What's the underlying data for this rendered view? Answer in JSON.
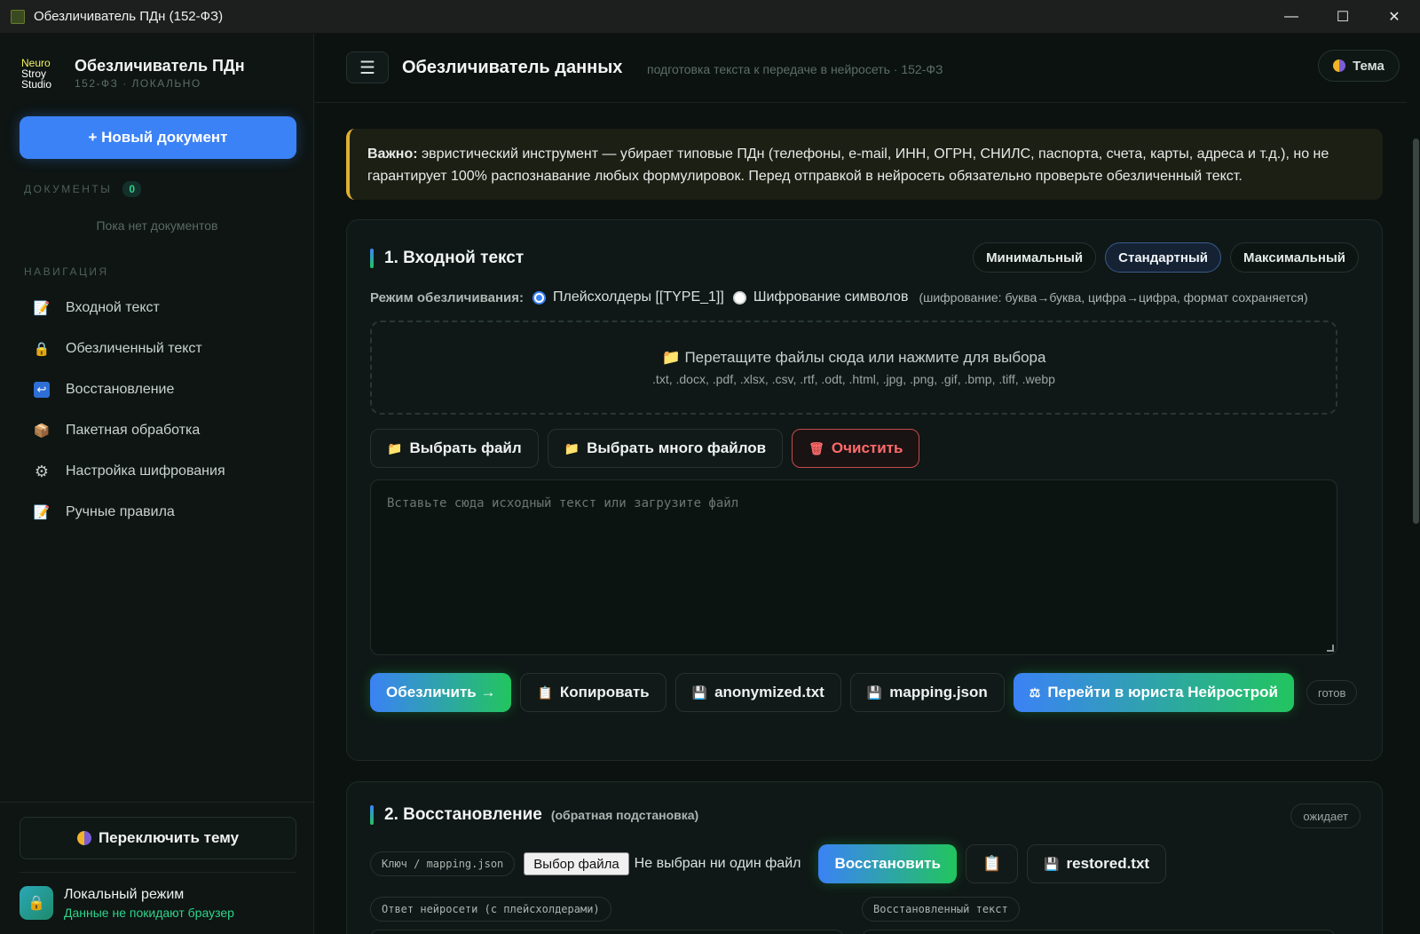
{
  "window": {
    "title": "Обезличиватель ПДн (152-ФЗ)",
    "minimize": "—",
    "maximize": "☐",
    "close": "✕"
  },
  "sidebar": {
    "brand_logo_lines": [
      "Neuro",
      "Stroy",
      "Studio"
    ],
    "brand_name": "Обезличиватель ПДн",
    "brand_sub": "152-ФЗ · ЛОКАЛЬНО",
    "new_doc_label": "+ Новый документ",
    "docs_label": "ДОКУМЕНТЫ",
    "docs_count": "0",
    "no_docs": "Пока нет документов",
    "nav_label": "НАВИГАЦИЯ",
    "nav_items": [
      {
        "label": "Входной текст",
        "icon": "memo-icon",
        "glyph": "📝"
      },
      {
        "label": "Обезличенный текст",
        "icon": "lock-icon",
        "glyph": "🔒"
      },
      {
        "label": "Восстановление",
        "icon": "return-arrow-icon",
        "glyph": "↩"
      },
      {
        "label": "Пакетная обработка",
        "icon": "package-icon",
        "glyph": "📦"
      },
      {
        "label": "Настройка шифрования",
        "icon": "gear-icon",
        "glyph": "⚙"
      },
      {
        "label": "Ручные правила",
        "icon": "memo-icon",
        "glyph": "📝"
      }
    ],
    "theme_toggle_label": "Переключить тему",
    "local_title": "Локальный режим",
    "local_sub": "Данные не покидают браузер"
  },
  "header": {
    "menu_glyph": "☰",
    "title": "Обезличиватель данных",
    "subtitle": "подготовка текста к передаче в нейросеть · 152-ФЗ",
    "theme_label": "Тема"
  },
  "notice": {
    "strong": "Важно:",
    "text": " эвристический инструмент — убирает типовые ПДн (телефоны, e-mail, ИНН, ОГРН, СНИЛС, паспорта, счета, карты, адреса и т.д.), но не гарантирует 100% распознавание любых формулировок. Перед отправкой в нейросеть обязательно проверьте обезличенный текст."
  },
  "input_card": {
    "title": "1. Входной текст",
    "levels": [
      "Минимальный",
      "Стандартный",
      "Максимальный"
    ],
    "active_level": "Стандартный",
    "mode_label": "Режим обезличивания:",
    "mode_placeholders": "Плейсхолдеры [[TYPE_1]]",
    "mode_cipher": "Шифрование символов",
    "mode_note": "(шифрование: буква→буква, цифра→цифра, формат сохраняется)",
    "dropzone_text": "Перетащите файлы сюда или нажмите для выбора",
    "dropzone_types": ".txt, .docx, .pdf, .xlsx, .csv, .rtf, .odt, .html, .jpg, .png, .gif, .bmp, .tiff, .webp",
    "choose_file": "Выбрать файл",
    "choose_many": "Выбрать много файлов",
    "clear": "Очистить",
    "textarea_placeholder": "Вставьте сюда исходный текст или загрузите файл",
    "anonymize": "Обезличить →",
    "copy": "Копировать",
    "save_anonymized": "anonymized.txt",
    "save_mapping": "mapping.json",
    "go_lawyer": "Перейти в юриста Нейрострой",
    "status": "готов"
  },
  "restore_card": {
    "title": "2. Восстановление",
    "title_note": "(обратная подстановка)",
    "status": "ожидает",
    "key_label": "Ключ / mapping.json",
    "file_button": "Выбор файла",
    "file_none": "Не выбран ни один файл",
    "restore": "Восстановить",
    "save_restored": "restored.txt",
    "ai_answer_label": "Ответ нейросети (с плейсхолдерами)",
    "restored_label": "Восстановленный текст"
  }
}
